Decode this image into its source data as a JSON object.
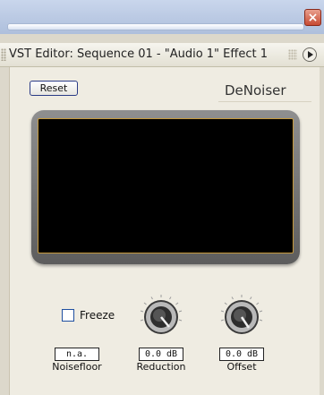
{
  "window": {
    "title": "VST Editor: Sequence 01 - \"Audio 1\" Effect 1",
    "close_glyph": "×"
  },
  "plugin": {
    "reset_label": "Reset",
    "name": "DeNoiser"
  },
  "controls": {
    "freeze_label": "Freeze",
    "noisefloor": {
      "value": "n.a.",
      "label": "Noisefloor"
    },
    "reduction": {
      "value": "0.0 dB",
      "label": "Reduction"
    },
    "offset": {
      "value": "0.0 dB",
      "label": "Offset"
    }
  }
}
